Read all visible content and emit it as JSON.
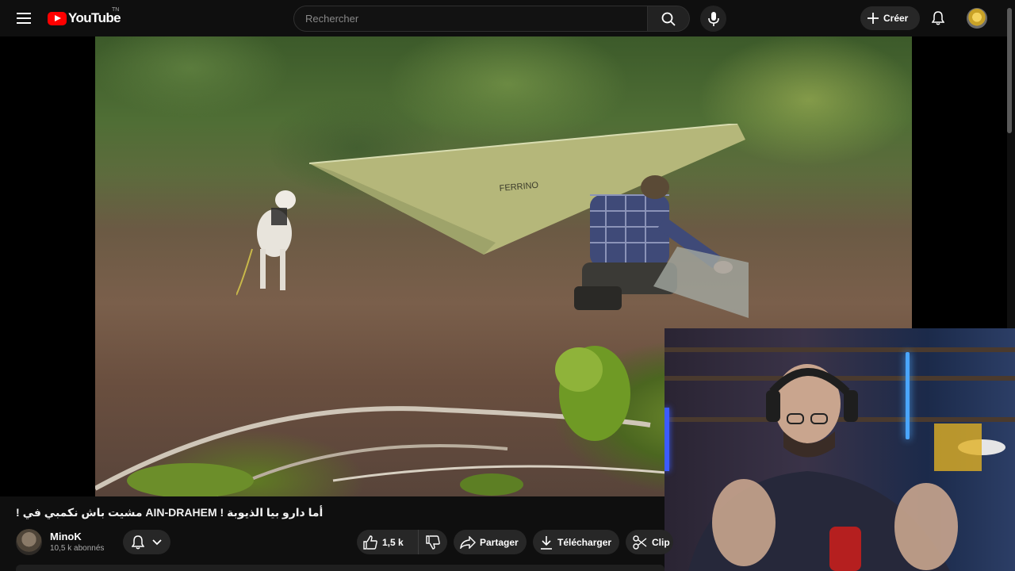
{
  "header": {
    "logo_text": "YouTube",
    "region_badge": "TN",
    "search_placeholder": "Rechercher",
    "create_label": "Créer"
  },
  "video": {
    "title": "! مشيت باش نكمبي في AIN-DRAHEM ! أما دارو بيا الذيوبة",
    "tarp_brand": "FERRINO"
  },
  "channel": {
    "name": "MinoK",
    "subscribers": "10,5 k abonnés"
  },
  "actions": {
    "like_count": "1,5 k",
    "share_label": "Partager",
    "download_label": "Télécharger",
    "clip_label": "Clip"
  },
  "colors": {
    "background": "#0f0f0f",
    "brand_red": "#ff0000",
    "pill_bg": "#272727"
  },
  "icons": [
    "menu-icon",
    "youtube-logo-icon",
    "search-icon",
    "mic-icon",
    "plus-icon",
    "bell-icon",
    "thumb-up-icon",
    "thumb-down-icon",
    "share-icon",
    "download-icon",
    "scissors-icon",
    "chevron-down-icon"
  ]
}
